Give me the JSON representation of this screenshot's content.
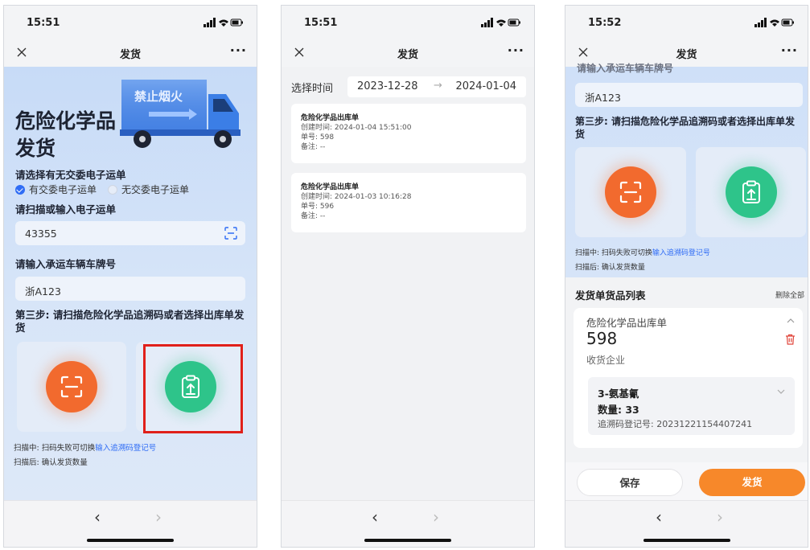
{
  "phone1": {
    "time": "15:51",
    "title": "发货",
    "more": "···",
    "heading_line1": "危险化学品",
    "heading_line2": "发货",
    "truck_text": "禁止烟火",
    "q_waybill": "请选择有无交委电子运单",
    "opt_yes": "有交委电子运单",
    "opt_no": "无交委电子运单",
    "q_scan": "请扫描或输入电子运单",
    "waybill_value": "43355",
    "q_plate": "请输入承运车辆车牌号",
    "plate_value": "浙A123",
    "step3": "第三步: 请扫描危险化学品追溯码或者选择出库单发货",
    "note1_prefix": "扫描中: 扫码失败可切换",
    "note1_link": "输入追溯码登记号",
    "note2": "扫描后: 确认发货数量"
  },
  "phone2": {
    "time": "15:51",
    "title": "发货",
    "more": "···",
    "date_label": "选择时间",
    "date_from": "2023-12-28",
    "date_arrow": "→",
    "date_to": "2024-01-04",
    "records": [
      {
        "title": "危险化学品出库单",
        "created": "创建时间: 2024-01-04 15:51:00",
        "no": "单号: 598",
        "remark": "备注: --"
      },
      {
        "title": "危险化学品出库单",
        "created": "创建时间: 2024-01-03 10:16:28",
        "no": "单号: 596",
        "remark": "备注: --"
      }
    ]
  },
  "phone3": {
    "time": "15:52",
    "title": "发货",
    "more": "···",
    "cut_label": "请输入承运车辆车牌号",
    "plate_value": "浙A123",
    "step3": "第三步: 请扫描危险化学品追溯码或者选择出库单发货",
    "note1_prefix": "扫描中: 扫码失败可切换",
    "note1_link": "输入追溯码登记号",
    "note2": "扫描后: 确认发货数量",
    "list_title": "发货单货品列表",
    "delete_all": "删除全部",
    "order_title": "危险化学品出库单",
    "order_no": "598",
    "receiver_label": "收货企业",
    "item_name": "3-氨基氰",
    "item_qty": "数量: 33",
    "item_trace": "追溯码登记号: 20231221154407241",
    "save_label": "保存",
    "ship_label": "发货"
  },
  "nav": {
    "back": "‹",
    "forward": "›"
  },
  "colors": {
    "accent_blue": "#2f6cf5",
    "orange": "#f26a2e",
    "green": "#2ec48a",
    "highlight_red": "#e0201a",
    "ship_button": "#f7882a"
  }
}
